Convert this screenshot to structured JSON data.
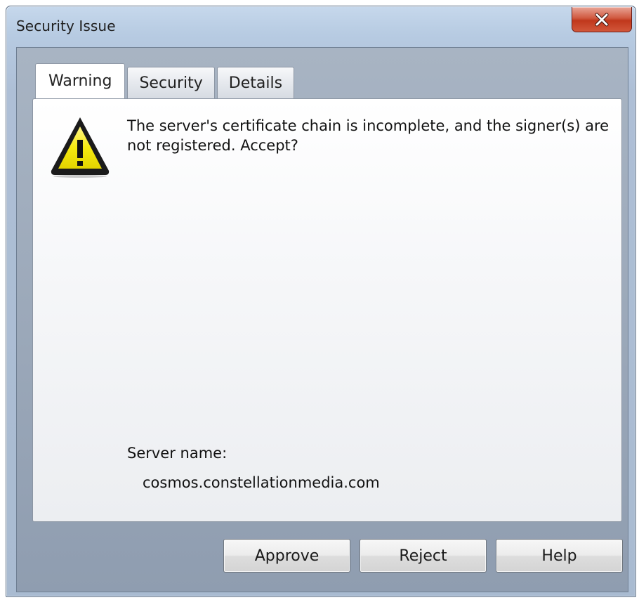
{
  "window": {
    "title": "Security Issue",
    "close_icon": "close-icon"
  },
  "tabs": [
    {
      "label": "Warning",
      "active": true
    },
    {
      "label": "Security",
      "active": false
    },
    {
      "label": "Details",
      "active": false
    }
  ],
  "warning": {
    "icon": "warning-triangle-icon",
    "message": "The server's certificate chain is incomplete, and the signer(s) are not registered. Accept?",
    "server_label": "Server name:",
    "server_value": "cosmos.constellationmedia.com"
  },
  "buttons": {
    "approve": "Approve",
    "reject": "Reject",
    "help": "Help"
  },
  "colors": {
    "warning_fill": "#f2e600",
    "close_button": "#c8452b"
  }
}
